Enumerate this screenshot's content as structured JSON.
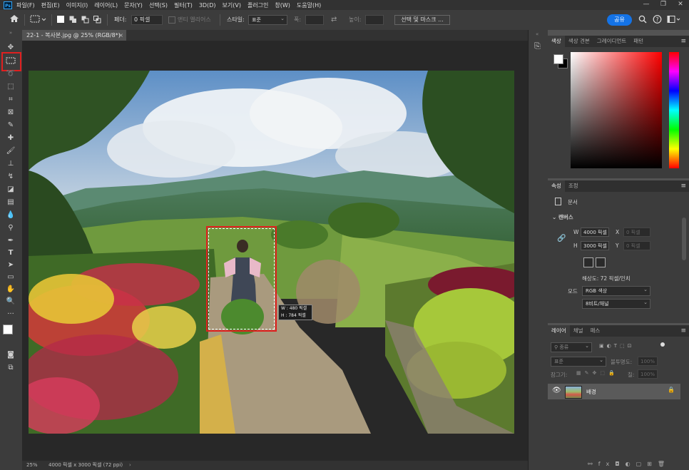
{
  "app": {
    "logo": "Ps",
    "window_controls": [
      "—",
      "❐",
      "✕"
    ]
  },
  "menu": [
    "파일(F)",
    "편집(E)",
    "이미지(I)",
    "레이어(L)",
    "문자(Y)",
    "선택(S)",
    "필터(T)",
    "3D(D)",
    "보기(V)",
    "플러그인",
    "창(W)",
    "도움말(H)"
  ],
  "options": {
    "feather_label": "페더:",
    "feather_value": "0 픽셀",
    "antialias_label": "앤티 앨리어스",
    "style_label": "스타일:",
    "style_value": "표준",
    "width_label": "폭:",
    "height_label": "높이:",
    "select_mask_button": "선택 및 마스크 ...",
    "share_button": "공유"
  },
  "document": {
    "tab_title": "22-1 - 복사본.jpg @ 25% (RGB/8*)",
    "zoom": "25%",
    "status_info": "4000 픽셀 x 3000 픽셀 (72 ppi)",
    "tooltip_w": "W : 480 픽셀",
    "tooltip_h": "H : 784 픽셀"
  },
  "color_panel": {
    "tabs": [
      "색상",
      "색상 견본",
      "그레이디언트",
      "패턴"
    ],
    "active": 0
  },
  "properties_panel": {
    "tabs": [
      "속성",
      "조정"
    ],
    "doc_label": "문서",
    "canvas_title": "캔버스",
    "w_label": "W",
    "w_value": "4000 픽셀",
    "h_label": "H",
    "h_value": "3000 픽셀",
    "x_label": "X",
    "y_label": "Y",
    "x_placeholder": "0 픽셀",
    "y_placeholder": "0 픽셀",
    "resolution": "해상도: 72 픽셀/인치",
    "mode_label": "모드",
    "mode_value": "RGB 색상",
    "depth_value": "8비트/채널"
  },
  "layers_panel": {
    "tabs": [
      "레이어",
      "채널",
      "패스"
    ],
    "filter_kind": "종류",
    "blend_mode": "표준",
    "opacity_label": "불투명도:",
    "opacity_value": "100%",
    "lock_label": "잠그기:",
    "fill_label": "칠:",
    "fill_value": "100%",
    "layer_name": "배경"
  },
  "colors": {
    "accent": "#1473e6",
    "highlight_red": "#e02020",
    "panel_bg": "#3c3c3c",
    "app_bg": "#535353"
  },
  "icons": {
    "home": "home-icon",
    "search": "search-icon",
    "help": "help-icon",
    "workspace": "workspace-icon",
    "visibility": "eye-icon",
    "lock": "lock-icon"
  }
}
